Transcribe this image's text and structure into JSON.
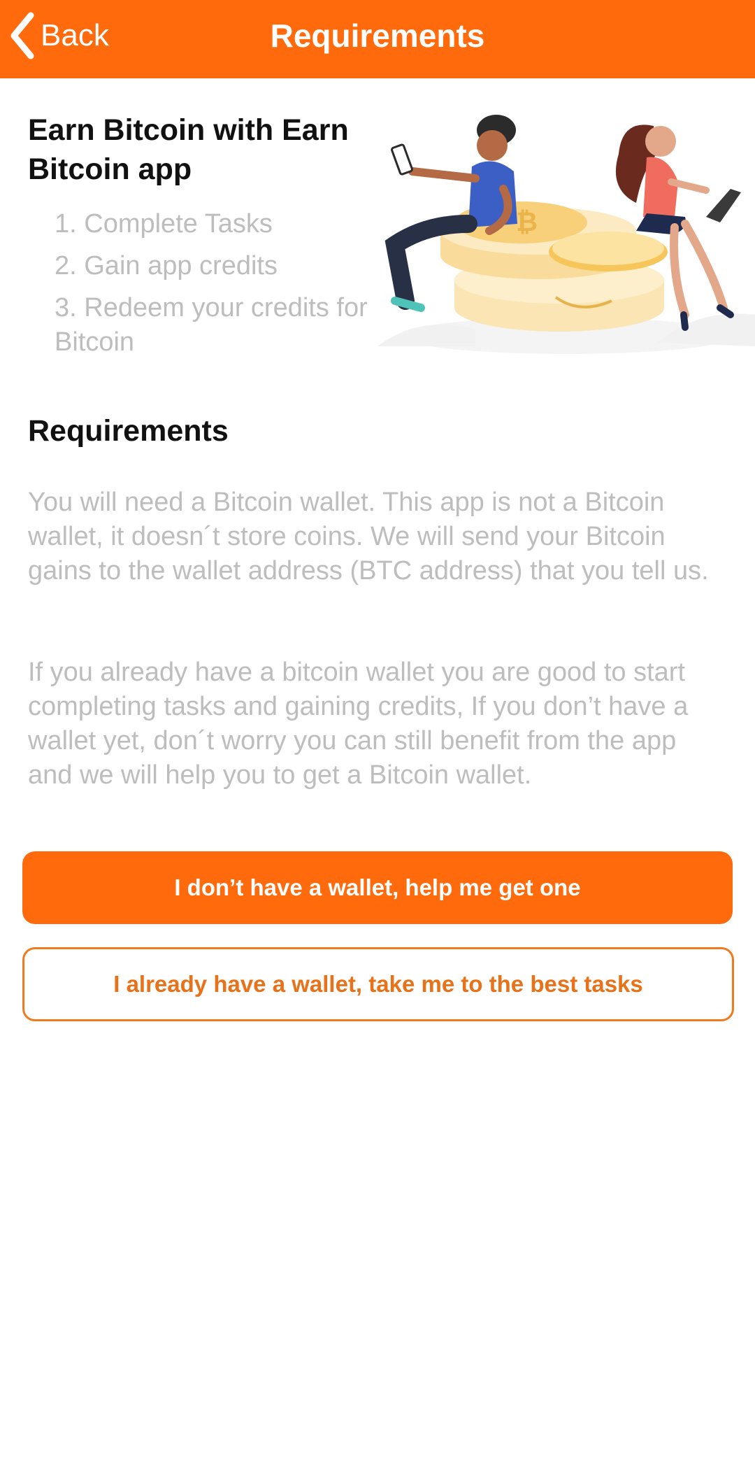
{
  "header": {
    "back_label": "Back",
    "title": "Requirements",
    "background_color": "#FF6A0C"
  },
  "intro": {
    "title": "Earn Bitcoin with Earn Bitcoin app",
    "steps": [
      "1. Complete Tasks",
      "2. Gain app credits",
      "3. Redeem your credits for Bitcoin"
    ],
    "illustration_icon": "people-sitting-on-bitcoin-coins"
  },
  "requirements": {
    "title": "Requirements",
    "paragraph1": "You will need a Bitcoin wallet. This app is not a Bitcoin wallet, it doesn´t store coins. We will send your Bitcoin gains to the wallet address (BTC address) that you tell us.",
    "paragraph2": "If you already have a bitcoin wallet you are good to start completing tasks and gaining credits, If you don’t have a wallet yet, don´t worry you can still benefit from the app and we will help you to get a Bitcoin wallet."
  },
  "actions": {
    "primary_label": "I don’t have a wallet, help me get one",
    "secondary_label": "I already have a wallet, take me to the best tasks",
    "accent_color": "#FF6A0C",
    "muted_text_color": "#BDBDBD"
  }
}
